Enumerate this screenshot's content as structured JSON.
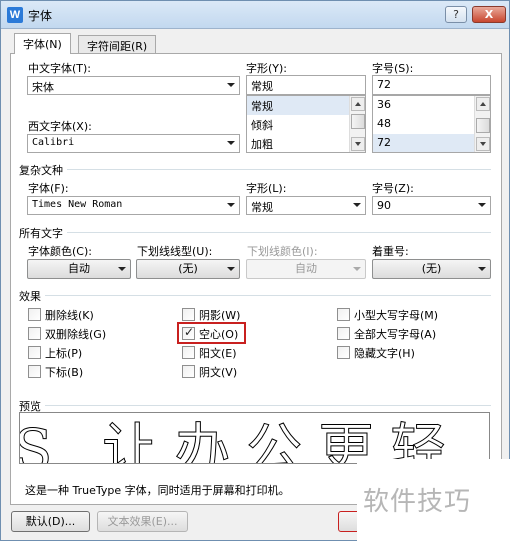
{
  "window": {
    "app_icon": "W",
    "title": "字体",
    "help_label": "?",
    "close_label": "X"
  },
  "tabs": [
    {
      "label": "字体(N)"
    },
    {
      "label": "字符间距(R)"
    }
  ],
  "chinese_font": {
    "label": "中文字体(T):",
    "value": "宋体"
  },
  "style": {
    "label": "字形(Y):",
    "value": "常规",
    "options": [
      "常规",
      "倾斜",
      "加粗"
    ]
  },
  "size": {
    "label": "字号(S):",
    "value": "72",
    "options": [
      "36",
      "48",
      "72"
    ]
  },
  "western_font": {
    "label": "西文字体(X):",
    "value": "Calibri"
  },
  "complex": {
    "section": "复杂文种",
    "font_label": "字体(F):",
    "font_value": "Times New Roman",
    "style_label": "字形(L):",
    "style_value": "常规",
    "size_label": "字号(Z):",
    "size_value": "90"
  },
  "all_text": {
    "section": "所有文字",
    "color_label": "字体颜色(C):",
    "color_value": "自动",
    "underline_label": "下划线线型(U):",
    "underline_value": "(无)",
    "underline_color_label": "下划线颜色(I):",
    "underline_color_value": "自动",
    "emphasis_label": "着重号:",
    "emphasis_value": "(无)"
  },
  "effects": {
    "section": "效果",
    "items": [
      {
        "label": "删除线(K)",
        "checked": false
      },
      {
        "label": "双删除线(G)",
        "checked": false
      },
      {
        "label": "上标(P)",
        "checked": false
      },
      {
        "label": "下标(B)",
        "checked": false
      },
      {
        "label": "阴影(W)",
        "checked": false
      },
      {
        "label": "空心(O)",
        "checked": true
      },
      {
        "label": "阳文(E)",
        "checked": false
      },
      {
        "label": "阴文(V)",
        "checked": false
      },
      {
        "label": "小型大写字母(M)",
        "checked": false
      },
      {
        "label": "全部大写字母(A)",
        "checked": false
      },
      {
        "label": "隐藏文字(H)",
        "checked": false
      }
    ]
  },
  "preview": {
    "section": "预览",
    "sample": "S 让办公更轻",
    "description": "这是一种 TrueType 字体，同时适用于屏幕和打印机。"
  },
  "buttons": {
    "default": "默认(D)...",
    "text_effects": "文本效果(E)..."
  },
  "watermark": "软件技巧",
  "colors": {
    "highlight_border": "#c8201f",
    "selected_item": "#dfe9f5"
  }
}
